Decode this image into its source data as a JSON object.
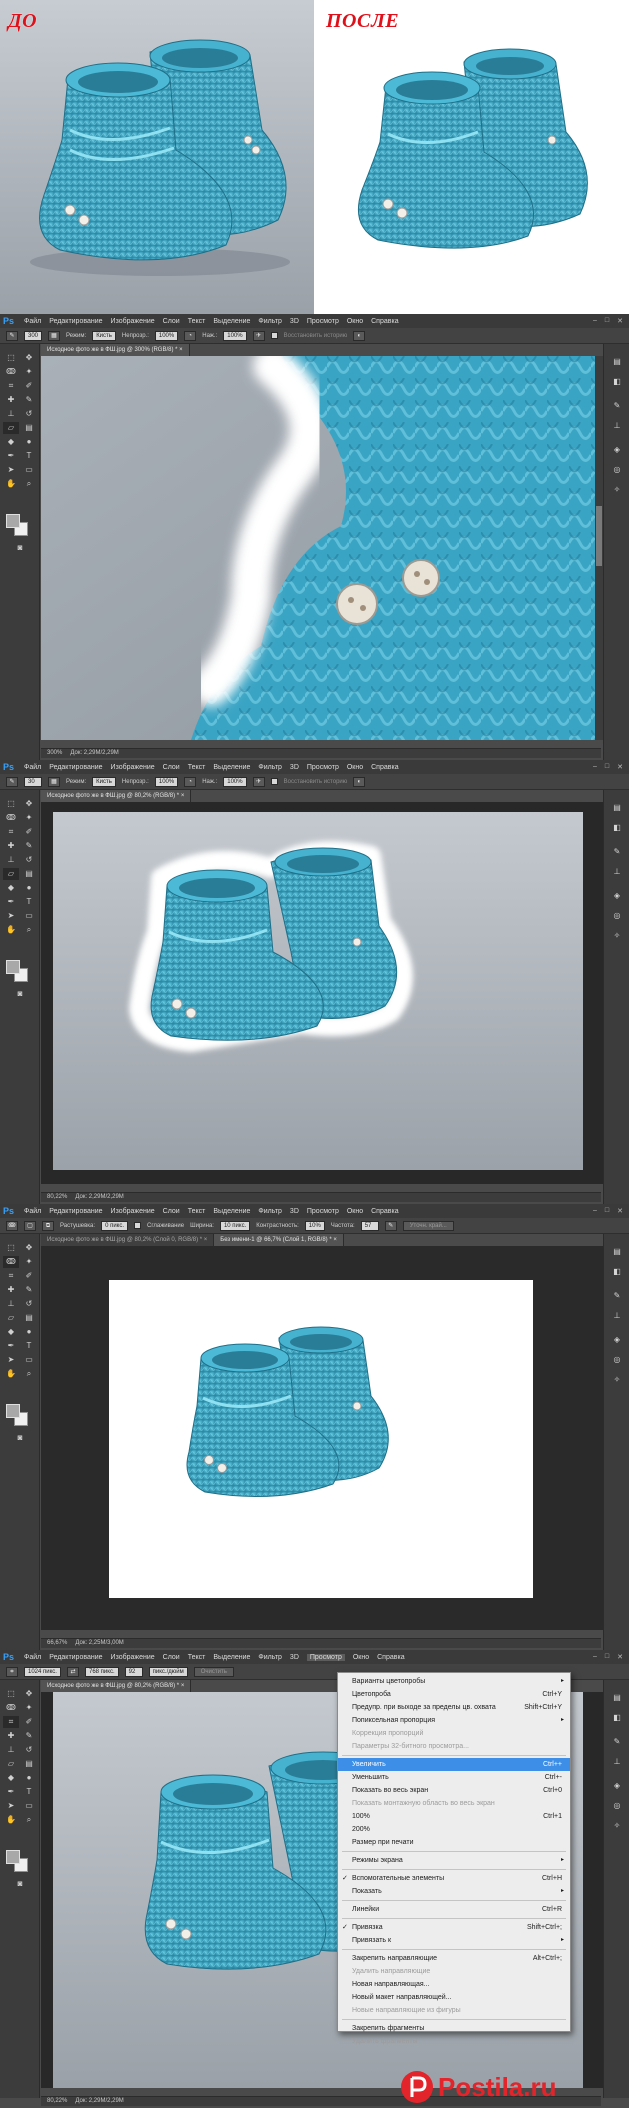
{
  "comparison": {
    "before_label": "ДО",
    "after_label": "ПОСЛЕ"
  },
  "photoshop": {
    "logo": "Ps",
    "menu": [
      "Файл",
      "Редактирование",
      "Изображение",
      "Слои",
      "Текст",
      "Выделение",
      "Фильтр",
      "3D",
      "Просмотр",
      "Окно",
      "Справка"
    ],
    "window_buttons": [
      "–",
      "□",
      "✕"
    ]
  },
  "screens": [
    {
      "id": "screen1",
      "options": {
        "brush_size": "300",
        "mode_label": "Режим:",
        "mode_value": "Кисть",
        "opacity_label": "Непрозр.:",
        "opacity_value": "100%",
        "flow_label": "Наж.:",
        "flow_value": "100%",
        "restore_history": "Восстановить историю"
      },
      "tabs": [
        {
          "label": "Исходное фото же в ФШ.jpg @ 300% (RGB/8) *",
          "close": "×"
        }
      ],
      "status": {
        "zoom": "300%",
        "doc": "Док: 2,29M/2,29M"
      }
    },
    {
      "id": "screen2",
      "options": {
        "brush_size": "30",
        "mode_label": "Режим:",
        "mode_value": "Кисть",
        "opacity_label": "Непрозр.:",
        "opacity_value": "100%",
        "flow_label": "Наж.:",
        "flow_value": "100%",
        "restore_history": "Восстановить историю"
      },
      "tabs": [
        {
          "label": "Исходное фото же в ФШ.jpg @ 80,2% (RGB/8) *",
          "close": "×"
        }
      ],
      "status": {
        "zoom": "80,22%",
        "doc": "Док: 2,29M/2,29M"
      }
    },
    {
      "id": "screen3",
      "options": {
        "feather_label": "Растушевка:",
        "feather_value": "0 пикс.",
        "antialias_label": "Сглаживание",
        "width_label": "Ширина:",
        "width_value": "10 пикс.",
        "contrast_label": "Контрастность:",
        "contrast_value": "10%",
        "frequency_label": "Частота:",
        "frequency_value": "57",
        "refine_button": "Уточн. край..."
      },
      "tabs": [
        {
          "label": "Исходное фото же в ФШ.jpg @ 80,2% (Слой 0, RGB/8) *",
          "close": "×"
        },
        {
          "label": "Без имени-1 @ 66,7% (Слой 1, RGB/8) *",
          "close": "×"
        }
      ],
      "status": {
        "zoom": "66,67%",
        "doc": "Док: 2,25M/3,00M"
      }
    },
    {
      "id": "screen4",
      "options": {
        "width_value": "1024 пикс.",
        "height_value": "768 пикс.",
        "resolution_value": "92",
        "unit_value": "пикс./дюйм",
        "clear_button": "Очистить"
      },
      "tabs": [
        {
          "label": "Исходное фото же в ФШ.jpg @ 80,2% (RGB/8) *",
          "close": "×"
        }
      ],
      "status": {
        "zoom": "80,22%",
        "doc": "Док: 2,29M/2,29M"
      }
    }
  ],
  "view_menu": {
    "active_menu": "Просмотр",
    "items": [
      {
        "label": "Варианты цветопробы",
        "shortcut": "",
        "arrow": "▸"
      },
      {
        "label": "Цветопроба",
        "shortcut": "Ctrl+Y"
      },
      {
        "label": "Предупр. при выходе за пределы цв. охвата",
        "shortcut": "Shift+Ctrl+Y"
      },
      {
        "label": "Попиксельная пропорция",
        "shortcut": "",
        "arrow": "▸"
      },
      {
        "label": "Коррекция пропорций",
        "shortcut": "",
        "disabled": true
      },
      {
        "label": "Параметры 32-битного просмотра...",
        "shortcut": "",
        "disabled": true
      },
      {
        "sep": true
      },
      {
        "label": "Увеличить",
        "shortcut": "Ctrl++",
        "highlight": true
      },
      {
        "label": "Уменьшить",
        "shortcut": "Ctrl+-"
      },
      {
        "label": "Показать во весь экран",
        "shortcut": "Ctrl+0"
      },
      {
        "label": "Показать монтажную область во весь экран",
        "shortcut": "",
        "disabled": true
      },
      {
        "label": "100%",
        "shortcut": "Ctrl+1"
      },
      {
        "label": "200%",
        "shortcut": ""
      },
      {
        "label": "Размер при печати",
        "shortcut": ""
      },
      {
        "sep": true
      },
      {
        "label": "Режимы экрана",
        "shortcut": "",
        "arrow": "▸"
      },
      {
        "sep": true
      },
      {
        "label": "Вспомогательные элементы",
        "shortcut": "Ctrl+H",
        "checked": true
      },
      {
        "label": "Показать",
        "shortcut": "",
        "arrow": "▸"
      },
      {
        "sep": true
      },
      {
        "label": "Линейки",
        "shortcut": "Ctrl+R"
      },
      {
        "sep": true
      },
      {
        "label": "Привязка",
        "shortcut": "Shift+Ctrl+;",
        "checked": true
      },
      {
        "label": "Привязать к",
        "shortcut": "",
        "arrow": "▸"
      },
      {
        "sep": true
      },
      {
        "label": "Закрепить направляющие",
        "shortcut": "Alt+Ctrl+;"
      },
      {
        "label": "Удалить направляющие",
        "shortcut": "",
        "disabled": true
      },
      {
        "label": "Новая направляющая...",
        "shortcut": ""
      },
      {
        "label": "Новый макет направляющей...",
        "shortcut": ""
      },
      {
        "label": "Новые направляющие из фигуры",
        "shortcut": "",
        "disabled": true
      },
      {
        "sep": true
      },
      {
        "label": "Закрепить фрагменты",
        "shortcut": ""
      },
      {
        "label": "Удалить фрагменты",
        "shortcut": "",
        "disabled": true
      }
    ]
  },
  "watermark": {
    "text": "Postila.ru",
    "brand_color": "#e3242b"
  }
}
